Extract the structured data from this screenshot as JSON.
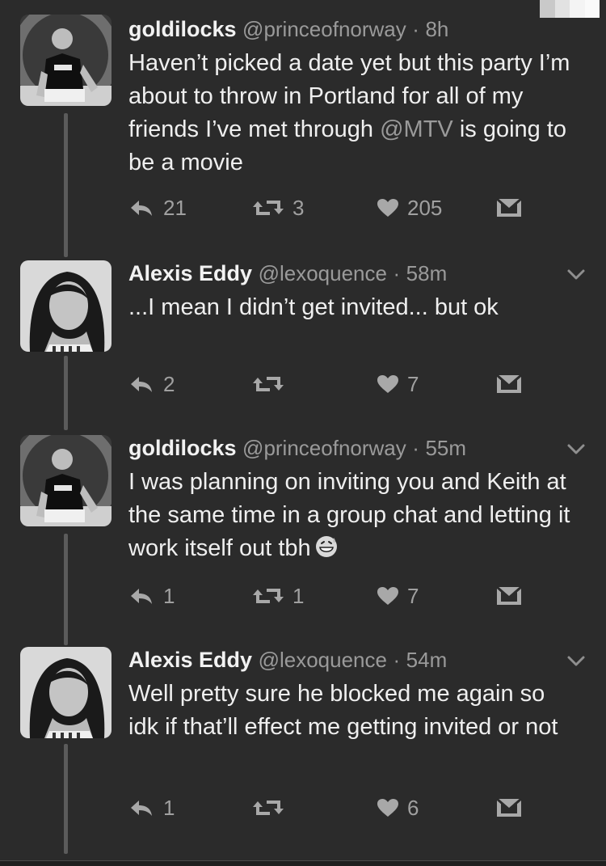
{
  "tweets": [
    {
      "name": "goldilocks",
      "handle": "@princeofnorway",
      "separator": "·",
      "time": "8h",
      "text_before": "Haven’t picked a date yet but this party I’m about to throw in Portland for all of my friends I’ve met through ",
      "mention": "@MTV",
      "text_after": " is going to be a movie",
      "replies": "21",
      "retweets": "3",
      "likes": "205",
      "avatar": "avatar-goldilocks",
      "has_menu": false
    },
    {
      "name": "Alexis Eddy",
      "handle": "@lexoquence",
      "separator": "·",
      "time": "58m",
      "text": "...I mean I didn’t get invited... but ok",
      "replies": "2",
      "retweets": "",
      "likes": "7",
      "avatar": "avatar-alexis",
      "has_menu": true
    },
    {
      "name": "goldilocks",
      "handle": "@princeofnorway",
      "separator": "·",
      "time": "55m",
      "text": "I was planning on inviting you and Keith at the same time in a group chat and letting it work itself out tbh",
      "emoji": "grinning-sweat-emoji",
      "replies": "1",
      "retweets": "1",
      "likes": "7",
      "avatar": "avatar-goldilocks",
      "has_menu": true
    },
    {
      "name": "Alexis Eddy",
      "handle": "@lexoquence",
      "separator": "·",
      "time": "54m",
      "text": "Well pretty sure he blocked me again so idk if that’ll effect me getting invited or not",
      "replies": "1",
      "retweets": "",
      "likes": "6",
      "avatar": "avatar-alexis",
      "has_menu": true
    }
  ],
  "icons": [
    "reply-icon",
    "retweet-icon",
    "heart-icon",
    "direct-message-icon",
    "chevron-down-icon"
  ],
  "colors": {
    "background": "#2b2b2b",
    "text": "#efefef",
    "muted": "#9a9a9a",
    "thread_line": "#5b5b5b"
  }
}
